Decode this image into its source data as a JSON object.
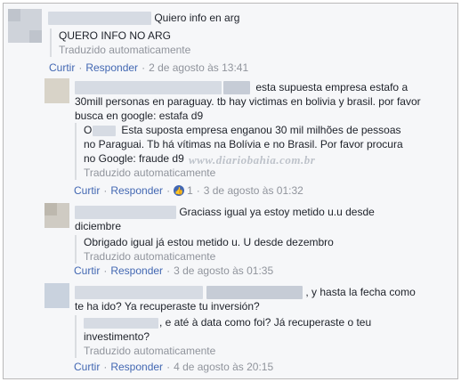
{
  "comments": [
    {
      "text": "Quiero info en arg",
      "translation": "QUERO INFO NO ARG",
      "auto_label": "Traduzido automaticamente",
      "reply": "Curtir",
      "respond": "Responder",
      "time": "2 de agosto às 13:41"
    },
    {
      "text_line1": "esta supuesta empresa estafo a",
      "text_rest": "30mill personas en paraguay. tb hay victimas en bolivia y brasil. por favor busca en google: estafa d9",
      "translation_first": "O",
      "translation_line1": "Esta suposta empresa enganou 30 mil milhões de pessoas",
      "translation_rest": "no Paraguai. Tb há vítimas na Bolívia e no Brasil. Por favor procura no Google: fraude d9",
      "auto_label": "Traduzido automaticamente",
      "reply": "Curtir",
      "respond": "Responder",
      "like_count": "1",
      "time": "3 de agosto às 01:32"
    },
    {
      "text_line1": "Graciass igual ya estoy metido u.u desde",
      "text_rest": "diciembre",
      "translation": "Obrigado igual já estou metido u. U desde dezembro",
      "auto_label": "Traduzido automaticamente",
      "reply": "Curtir",
      "respond": "Responder",
      "time": "3 de agosto às 01:35"
    },
    {
      "text_line1": ", y hasta la fecha como",
      "text_rest": "te ha ido? Ya recuperaste tu inversión?",
      "translation_line1": ", e até à data como foi? Já recuperaste o teu",
      "translation_rest": "investimento?",
      "auto_label": "Traduzido automaticamente",
      "reply": "Curtir",
      "respond": "Responder",
      "time": "4 de agosto às 20:15"
    }
  ],
  "watermark": "www.diariobahia.com.br",
  "colors": {
    "link": "#4267b2",
    "meta": "#90949c",
    "background": "#f6f7f9"
  }
}
